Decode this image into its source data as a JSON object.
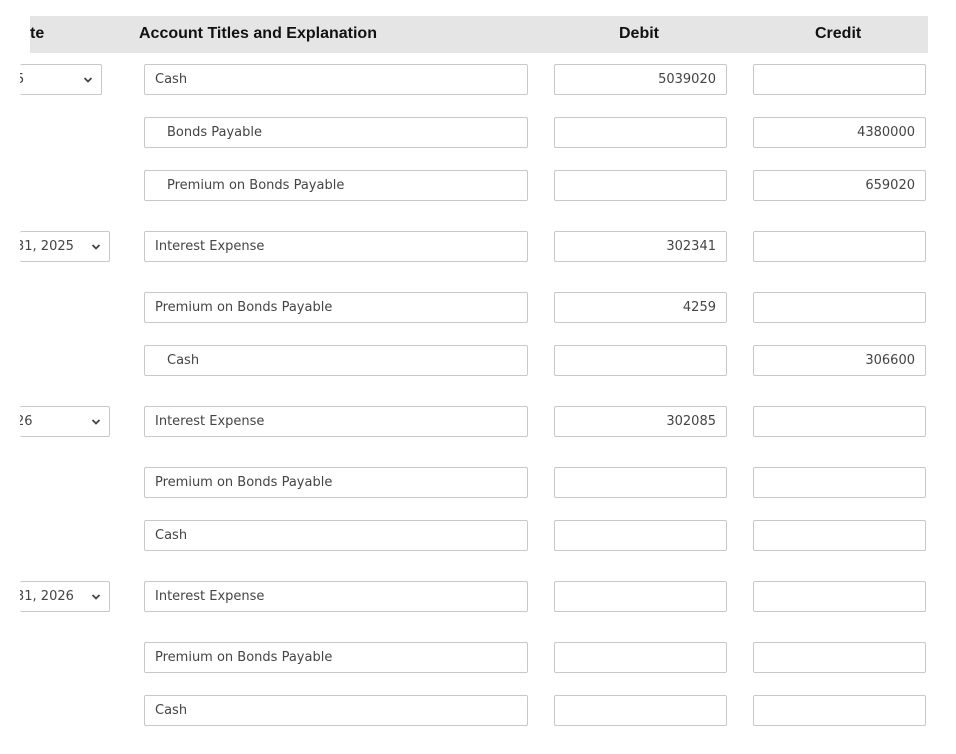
{
  "header": {
    "date": "te",
    "account": "Account Titles and Explanation",
    "debit": "Debit",
    "credit": "Credit"
  },
  "rows": [
    {
      "date": "5",
      "account": "Cash",
      "indent": false,
      "debit": "5039020",
      "credit": ""
    },
    {
      "date": null,
      "account": "Bonds Payable",
      "indent": true,
      "debit": "",
      "credit": "4380000"
    },
    {
      "date": null,
      "account": "Premium on Bonds Payable",
      "indent": true,
      "debit": "",
      "credit": "659020"
    },
    {
      "date": "31, 2025",
      "account": "Interest Expense",
      "indent": false,
      "debit": "302341",
      "credit": ""
    },
    {
      "date": null,
      "account": "Premium on Bonds Payable",
      "indent": false,
      "debit": "4259",
      "credit": ""
    },
    {
      "date": null,
      "account": "Cash",
      "indent": true,
      "debit": "",
      "credit": "306600"
    },
    {
      "date": "26",
      "account": "Interest Expense",
      "indent": false,
      "debit": "302085",
      "credit": ""
    },
    {
      "date": null,
      "account": "Premium on Bonds Payable",
      "indent": false,
      "debit": "",
      "credit": ""
    },
    {
      "date": null,
      "account": "Cash",
      "indent": false,
      "debit": "",
      "credit": ""
    },
    {
      "date": "31, 2026",
      "account": "Interest Expense",
      "indent": false,
      "debit": "",
      "credit": ""
    },
    {
      "date": null,
      "account": "Premium on Bonds Payable",
      "indent": false,
      "debit": "",
      "credit": ""
    },
    {
      "date": null,
      "account": "Cash",
      "indent": false,
      "debit": "",
      "credit": ""
    }
  ],
  "icons": {
    "date_dropdown": "chevron-down-icon"
  }
}
